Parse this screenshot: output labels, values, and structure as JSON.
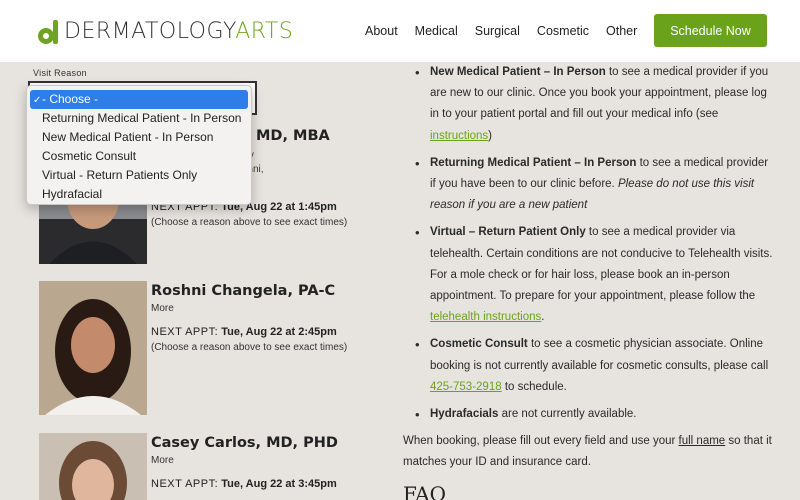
{
  "header": {
    "logo_main": "DERMATOLOGY",
    "logo_accent": "ARTS",
    "nav": [
      "About",
      "Medical",
      "Surgical",
      "Cosmetic",
      "Other"
    ],
    "cta": "Schedule Now"
  },
  "form": {
    "visit_label": "Visit Reason",
    "options": [
      "- Choose -",
      "Returning Medical Patient - In Person",
      "New Medical Patient - In Person",
      "Cosmetic Consult",
      "Virtual - Return Patients Only",
      "Hydrafacial"
    ],
    "selected_index": 0
  },
  "providers": [
    {
      "name": "MD, MBA",
      "bio_lines": [
        "n appointment with any",
        "ster's team (Liza, Roshni,",
        "above. More"
      ],
      "next_label": "NEXT APPT:",
      "next_time": "Tue, Aug 22 at 1:45pm",
      "note": "(Choose a reason above to see exact times)"
    },
    {
      "name": "Roshni Changela, PA-C",
      "more": "More",
      "next_label": "NEXT APPT:",
      "next_time": "Tue, Aug 22 at 2:45pm",
      "note": "(Choose a reason above to see exact times)"
    },
    {
      "name": "Casey Carlos, MD, PHD",
      "more": "More",
      "next_label": "NEXT APPT:",
      "next_time": "Tue, Aug 22 at 3:45pm"
    }
  ],
  "info": {
    "items": [
      {
        "bold": "New Medical Patient – In Person",
        "text1": " to see a medical provider if you are new to our clinic. Once you book your appointment, please log in to your patient portal and fill out your medical info (see ",
        "link": "instructions",
        "text2": ")"
      },
      {
        "bold": "Returning Medical Patient – In Person",
        "text1": " to see a medical provider if you have been to our clinic before. ",
        "italic": "Please do not use this visit reason if you are a new patient"
      },
      {
        "bold": "Virtual – Return Patient Only",
        "text1": " to see a medical provider via telehealth. Certain conditions are not conducive to Telehealth visits. For a mole check or for hair loss, please book an in-person appointment. To prepare for your appointment, please follow the ",
        "link": "telehealth instructions",
        "text2": "."
      },
      {
        "bold": "Cosmetic Consult",
        "text1": " to see a cosmetic physician associate. Online booking is not currently available for cosmetic consults, please call ",
        "link": "425-753-2918",
        "text2": " to schedule."
      },
      {
        "bold": "Hydrafacials",
        "text1": " are not currently available."
      }
    ],
    "booking_1": "When booking, please fill out every field and use your ",
    "booking_link": "full name",
    "booking_2": " so that it matches your ID and insurance card.",
    "faq": "FAQ"
  }
}
